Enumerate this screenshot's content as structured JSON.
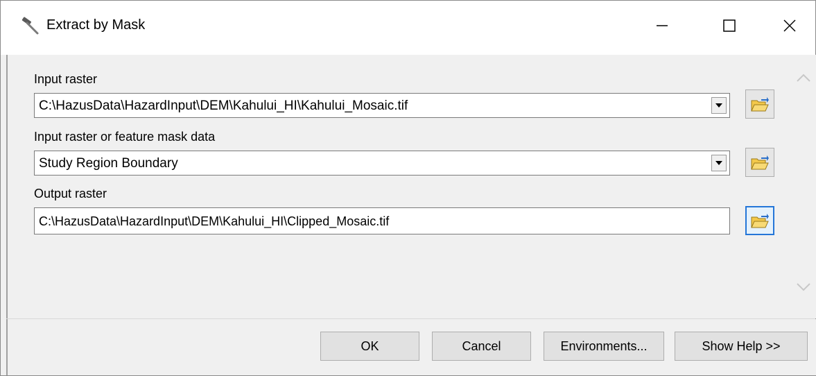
{
  "window": {
    "title": "Extract by Mask"
  },
  "titlebar_icons": {
    "app": "hammer-icon",
    "minimize": "minimize-icon",
    "maximize": "maximize-icon",
    "close": "close-icon"
  },
  "fields": {
    "input_raster": {
      "label": "Input raster",
      "value": "C:\\HazusData\\HazardInput\\DEM\\Kahului_HI\\Kahului_Mosaic.tif"
    },
    "mask_data": {
      "label": "Input raster or feature mask data",
      "value": "Study Region Boundary"
    },
    "output_raster": {
      "label": "Output raster",
      "value": "C:\\HazusData\\HazardInput\\DEM\\Kahului_HI\\Clipped_Mosaic.tif"
    }
  },
  "buttons": {
    "ok": "OK",
    "cancel": "Cancel",
    "environments": "Environments...",
    "show_help": "Show Help >>"
  },
  "colors": {
    "focus_border": "#2476d8",
    "window_bg": "#f0f0f0",
    "field_bg": "#ffffff",
    "folder_yellow": "#f3c84a"
  }
}
